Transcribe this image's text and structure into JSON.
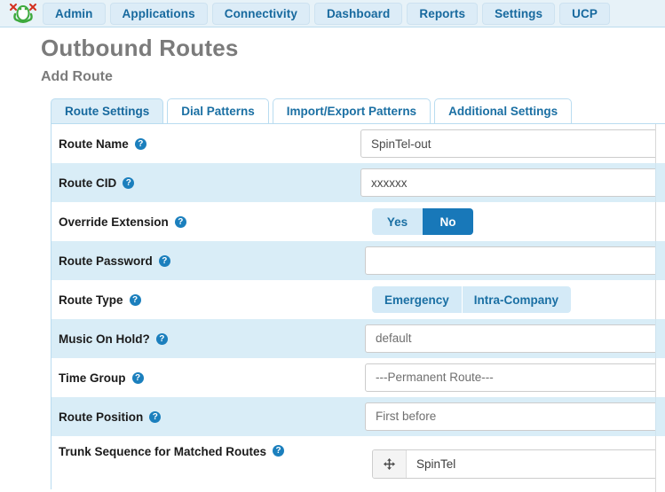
{
  "navbar": {
    "logo_icon": "freepbx-frog-logo",
    "items": [
      {
        "label": "Admin"
      },
      {
        "label": "Applications"
      },
      {
        "label": "Connectivity"
      },
      {
        "label": "Dashboard"
      },
      {
        "label": "Reports"
      },
      {
        "label": "Settings"
      },
      {
        "label": "UCP"
      }
    ]
  },
  "page": {
    "title": "Outbound Routes",
    "subtitle": "Add Route"
  },
  "tabs": [
    {
      "label": "Route Settings",
      "active": true
    },
    {
      "label": "Dial Patterns",
      "active": false
    },
    {
      "label": "Import/Export Patterns",
      "active": false
    },
    {
      "label": "Additional Settings",
      "active": false
    }
  ],
  "form": {
    "help_glyph": "?",
    "rows": {
      "route_name": {
        "label": "Route Name",
        "value": "SpinTel-out"
      },
      "route_cid": {
        "label": "Route CID",
        "value": "xxxxxx"
      },
      "override_extension": {
        "label": "Override Extension",
        "options": [
          "Yes",
          "No"
        ],
        "selected": "No"
      },
      "route_password": {
        "label": "Route Password",
        "value": ""
      },
      "route_type": {
        "label": "Route Type",
        "options": [
          "Emergency",
          "Intra-Company"
        ],
        "selected": ""
      },
      "music_on_hold": {
        "label": "Music On Hold?",
        "value": "default"
      },
      "time_group": {
        "label": "Time Group",
        "value": "---Permanent Route---"
      },
      "route_position": {
        "label": "Route Position",
        "value": "First before"
      },
      "trunk_sequence": {
        "label": "Trunk Sequence for Matched Routes",
        "drag_icon": "arrows-move-icon",
        "value": "SpinTel"
      }
    }
  },
  "colors": {
    "accent": "#1878b9",
    "link": "#1a6fa3",
    "stripe": "#d9edf7",
    "navbar_bg": "#e7f2f8",
    "panel_border": "#b9dcf0",
    "heading": "#7b7b7b"
  }
}
